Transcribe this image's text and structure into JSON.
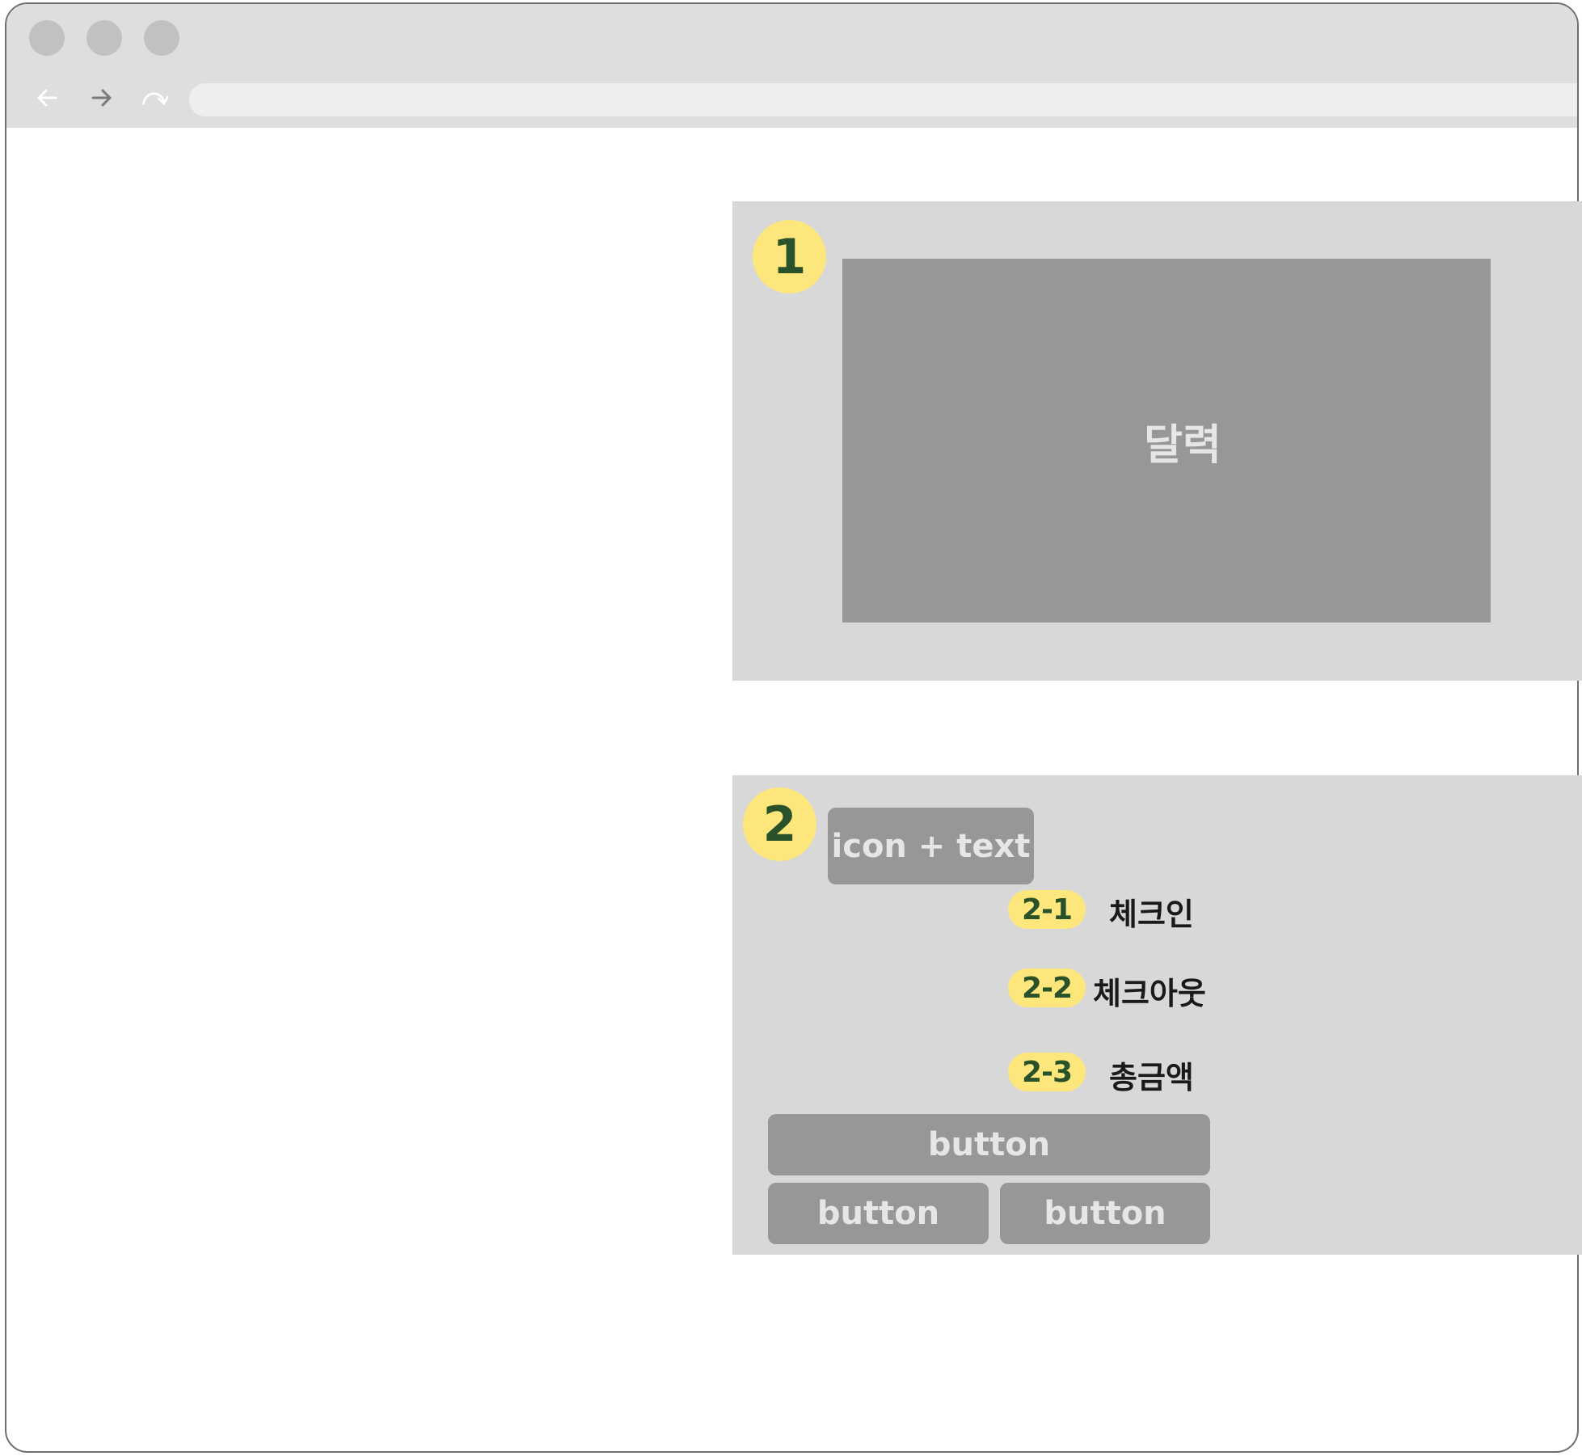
{
  "browser": {
    "nav_back_icon": "arrow-left-icon",
    "nav_forward_icon": "arrow-right-icon",
    "reload_icon": "reload-icon",
    "url": ""
  },
  "section1": {
    "number": "1",
    "calendar_label": "달력"
  },
  "section2": {
    "number": "2",
    "icon_text_label": "icon + text",
    "items": [
      {
        "badge": "2-1",
        "label": "체크인"
      },
      {
        "badge": "2-2",
        "label": "체크아웃"
      },
      {
        "badge": "2-3",
        "label": "총금액"
      }
    ],
    "buttons": {
      "wide": "button",
      "left": "button",
      "right": "button"
    }
  },
  "colors": {
    "badge_bg": "#fde77d",
    "badge_text": "#29522a",
    "panel_bg": "#d8d8d8",
    "placeholder_gray": "#979797"
  }
}
